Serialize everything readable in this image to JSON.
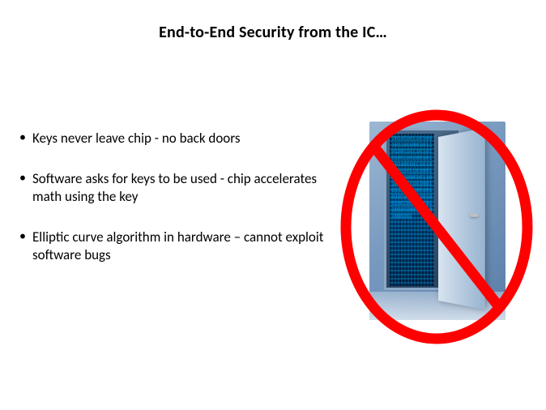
{
  "title": "End-to-End Security from the IC…",
  "bullets": {
    "0": "Keys never leave chip - no back doors",
    "1": "Software asks for keys to be used - chip accelerates math using the key",
    "2": "Elliptic curve algorithm in hardware – cannot exploit software bugs"
  },
  "illustration": {
    "description": "open-door-binary-code-prohibited",
    "prohibition_color": "#ff0000"
  }
}
